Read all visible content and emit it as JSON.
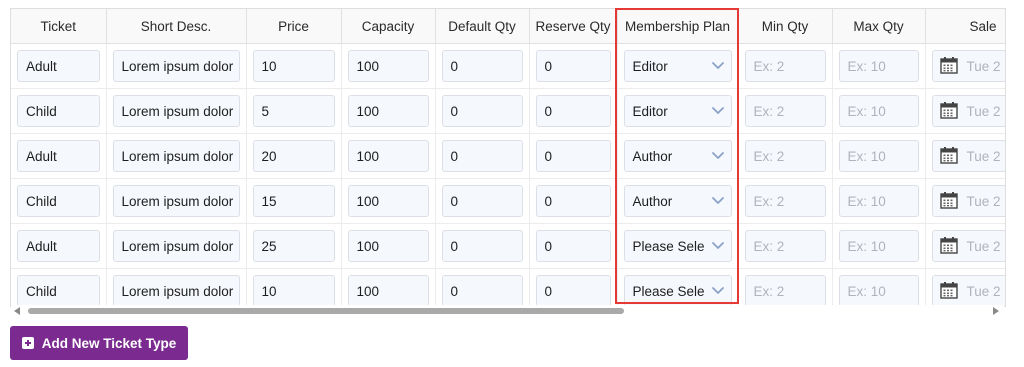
{
  "columns": [
    "Ticket",
    "Short Desc.",
    "Price",
    "Capacity",
    "Default Qty",
    "Reserve Qty",
    "Membership Plan",
    "Min Qty",
    "Max Qty",
    "Sale"
  ],
  "rows": [
    {
      "ticket": "Adult",
      "desc": "Lorem ipsum dolor",
      "price": "10",
      "capacity": "100",
      "default_qty": "0",
      "reserve_qty": "0",
      "plan": "Editor",
      "min_ph": "Ex: 2",
      "max_ph": "Ex: 10",
      "sale": "Tue 2"
    },
    {
      "ticket": "Child",
      "desc": "Lorem ipsum dolor",
      "price": "5",
      "capacity": "100",
      "default_qty": "0",
      "reserve_qty": "0",
      "plan": "Editor",
      "min_ph": "Ex: 2",
      "max_ph": "Ex: 10",
      "sale": "Tue 2"
    },
    {
      "ticket": "Adult",
      "desc": "Lorem ipsum dolor",
      "price": "20",
      "capacity": "100",
      "default_qty": "0",
      "reserve_qty": "0",
      "plan": "Author",
      "min_ph": "Ex: 2",
      "max_ph": "Ex: 10",
      "sale": "Tue 2"
    },
    {
      "ticket": "Child",
      "desc": "Lorem ipsum dolor",
      "price": "15",
      "capacity": "100",
      "default_qty": "0",
      "reserve_qty": "0",
      "plan": "Author",
      "min_ph": "Ex: 2",
      "max_ph": "Ex: 10",
      "sale": "Tue 2"
    },
    {
      "ticket": "Adult",
      "desc": "Lorem ipsum dolor",
      "price": "25",
      "capacity": "100",
      "default_qty": "0",
      "reserve_qty": "0",
      "plan": "Please Sele",
      "min_ph": "Ex: 2",
      "max_ph": "Ex: 10",
      "sale": "Tue 2"
    },
    {
      "ticket": "Child",
      "desc": "Lorem ipsum dolor",
      "price": "10",
      "capacity": "100",
      "default_qty": "0",
      "reserve_qty": "0",
      "plan": "Please Sele",
      "min_ph": "Ex: 2",
      "max_ph": "Ex: 10",
      "sale": "Tue 2"
    }
  ],
  "add_button_label": "Add New Ticket Type",
  "icons": {
    "select": "chevron-down-icon",
    "date": "calendar-icon",
    "add": "plus-square-icon",
    "scroll_left": "triangle-left-icon",
    "scroll_right": "triangle-right-icon"
  },
  "colors": {
    "accent": "#7b2b8f",
    "highlight": "#e53935"
  },
  "scroll": {
    "thumb_fraction": 0.6
  }
}
